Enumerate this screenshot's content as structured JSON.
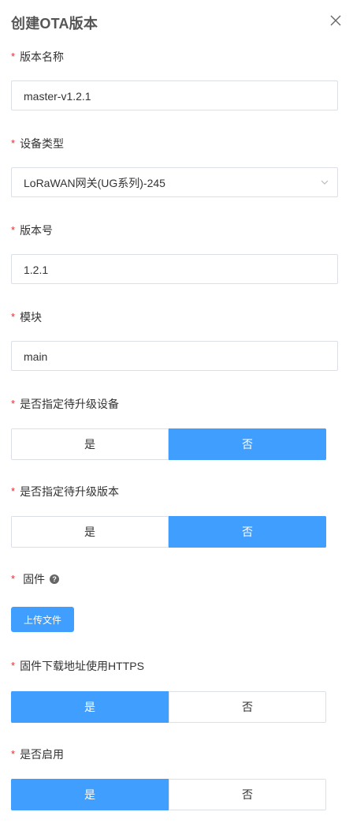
{
  "dialog": {
    "title": "创建OTA版本",
    "close_icon": "close-icon"
  },
  "form": {
    "required_mark": "*",
    "version_name": {
      "label": "版本名称",
      "value": "master-v1.2.1"
    },
    "device_type": {
      "label": "设备类型",
      "value": "LoRaWAN网关(UG系列)-245",
      "arrow_icon": "chevron-down-icon"
    },
    "version_number": {
      "label": "版本号",
      "value": "1.2.1"
    },
    "module": {
      "label": "模块",
      "value": "main"
    },
    "specify_devices": {
      "label": "是否指定待升级设备",
      "yes": "是",
      "no": "否",
      "selected": "no"
    },
    "specify_version": {
      "label": "是否指定待升级版本",
      "yes": "是",
      "no": "否",
      "selected": "no"
    },
    "firmware": {
      "label": "固件",
      "help_icon": "question-circle-icon",
      "help_glyph": "?",
      "upload_label": "上传文件"
    },
    "https_download": {
      "label": "固件下载地址使用HTTPS",
      "yes": "是",
      "no": "否",
      "selected": "yes"
    },
    "enabled": {
      "label": "是否启用",
      "yes": "是",
      "no": "否",
      "selected": "yes"
    }
  },
  "colors": {
    "primary": "#409eff",
    "required": "#f5222d",
    "border": "#dcdfe6"
  }
}
